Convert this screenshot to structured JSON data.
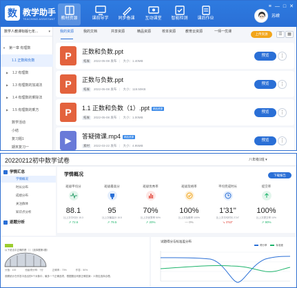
{
  "app": {
    "logo_char": "数",
    "title": "教学助手",
    "subtitle": "TEACHING ASSISTANT",
    "user_name": "苏嵘",
    "window_controls": [
      "≡",
      "—",
      "□",
      "✕"
    ]
  },
  "nav": [
    {
      "label": "教材资源",
      "icon": "book-icon",
      "active": true
    },
    {
      "label": "课前导学",
      "icon": "monitor-icon",
      "active": false
    },
    {
      "label": "同步备课",
      "icon": "pen-icon",
      "active": false
    },
    {
      "label": "互动课堂",
      "icon": "board-icon",
      "active": false
    },
    {
      "label": "智能检测",
      "icon": "check-icon",
      "active": false
    },
    {
      "label": "课后作业",
      "icon": "homework-icon",
      "active": false
    }
  ],
  "sidebar": {
    "header": "数学人教课标版七年...",
    "items": [
      {
        "label": "第一章 有理数",
        "level": 0,
        "active": false,
        "tri": "▼"
      },
      {
        "label": "1.1 正数和负数",
        "level": 1,
        "active": true,
        "tri": ""
      },
      {
        "label": "1.2 有理数",
        "level": 1,
        "active": false,
        "tri": "▶"
      },
      {
        "label": "1.3 有理数的加减法",
        "level": 1,
        "active": false,
        "tri": "▶"
      },
      {
        "label": "1.4 有理数的乘除法",
        "level": 1,
        "active": false,
        "tri": "▶"
      },
      {
        "label": "1.5 有理数的乘方",
        "level": 1,
        "active": false,
        "tri": "▶"
      },
      {
        "label": "数学活动",
        "level": 1,
        "active": false,
        "tri": ""
      },
      {
        "label": "小结",
        "level": 1,
        "active": false,
        "tri": ""
      },
      {
        "label": "复习题1",
        "level": 1,
        "active": false,
        "tri": ""
      },
      {
        "label": "期末复习一",
        "level": 1,
        "active": false,
        "tri": ""
      }
    ]
  },
  "tabs": [
    {
      "label": "我的资源",
      "active": true
    },
    {
      "label": "我的文档",
      "active": false
    },
    {
      "label": "共享资源",
      "active": false
    },
    {
      "label": "精品资源",
      "active": false
    },
    {
      "label": "校本资源",
      "active": false
    },
    {
      "label": "教育云资源",
      "active": false
    },
    {
      "label": "一师一优课",
      "active": false
    }
  ],
  "upload_label": "上传资源",
  "view_icons": [
    "☰",
    "▦"
  ],
  "files": [
    {
      "name": "正数和负数.ppt",
      "badge": "",
      "type": "P",
      "kind": "ppt",
      "tag": "拓展",
      "date": "2022-05-08 发布",
      "size": "大小：1.40MB",
      "preview": "预览",
      "more": "⋮"
    },
    {
      "name": "正数与负数.ppt",
      "badge": "",
      "type": "P",
      "kind": "ppt",
      "tag": "拓展",
      "date": "2022-05-08 发布",
      "size": "大小：119.50KB",
      "preview": "预览",
      "more": "⋮"
    },
    {
      "name": "1.1 正数和负数（1）.ppt",
      "badge": "精品资源",
      "type": "P",
      "kind": "ppt",
      "tag": "拓展",
      "date": "2022-05-08 发布",
      "size": "大小：1.00MB",
      "preview": "预览",
      "more": "⋮"
    },
    {
      "name": "答疑微课.mp4",
      "badge": "精品资源",
      "type": "▶",
      "kind": "mp4",
      "tag": "素材",
      "date": "2022-03-22 发布",
      "size": "大小：4.95MB",
      "preview": "预览",
      "more": "⋮"
    }
  ],
  "report": {
    "title": "20220212初中数学试卷",
    "select": "八年级1班 ▾",
    "sidebar": {
      "section1": "学情汇总",
      "items1": [
        "学情概况",
        "时长分布",
        "成绩分布",
        "关注群体",
        "知识点分析"
      ],
      "section2": "逐题分析"
    },
    "overview_title": "学情概况",
    "download_label": "下载报告",
    "metrics": [
      {
        "label": "班级平均分",
        "value": "88.1",
        "compare": "比上次平均分 15.3",
        "delta": "↗ 72.6",
        "dir": "up",
        "color": "#2a9d6a"
      },
      {
        "label": "班级最高分",
        "value": "95",
        "compare": "比上次最高分 15.5",
        "delta": "↗ 79.5",
        "dir": "up",
        "color": "#2a6fd6"
      },
      {
        "label": "班级优秀率",
        "value": "70%",
        "compare": "比上次优秀率 50%",
        "delta": "↗ 20%",
        "dir": "up",
        "color": "#e2463b"
      },
      {
        "label": "班级及格率",
        "value": "100%",
        "compare": "比上次及格率 100%",
        "delta": "— 0%",
        "dir": "none",
        "color": "#f2a51a"
      },
      {
        "label": "平均完成时长",
        "value": "1'31''",
        "compare": "比上次平均时长 2'24''",
        "delta": "↘ 0'53''",
        "dir": "down",
        "color": "#2a6fd6"
      },
      {
        "label": "提交率",
        "value": "100%",
        "compare": "比上次提交率 10%",
        "delta": "↗ 90%",
        "dir": "up",
        "color": "#1bb36a"
      }
    ],
    "question": {
      "text": "以下说法中正确的是（     ）（选择题第1题）",
      "stats": [
        "分值：100",
        "班级得分率：7分",
        "正确率：70%",
        "作答：50%"
      ],
      "text2": "观察统计在作答中选出的5个对象中，最多一个正确选项，根据题目判断正确答案：人物应选择合理。"
    },
    "chart_title": "试题得分与标准差分布",
    "legend": [
      {
        "name": "得分率",
        "color": "#2a6fd6"
      },
      {
        "name": "标准差",
        "color": "#1bb36a"
      }
    ]
  }
}
